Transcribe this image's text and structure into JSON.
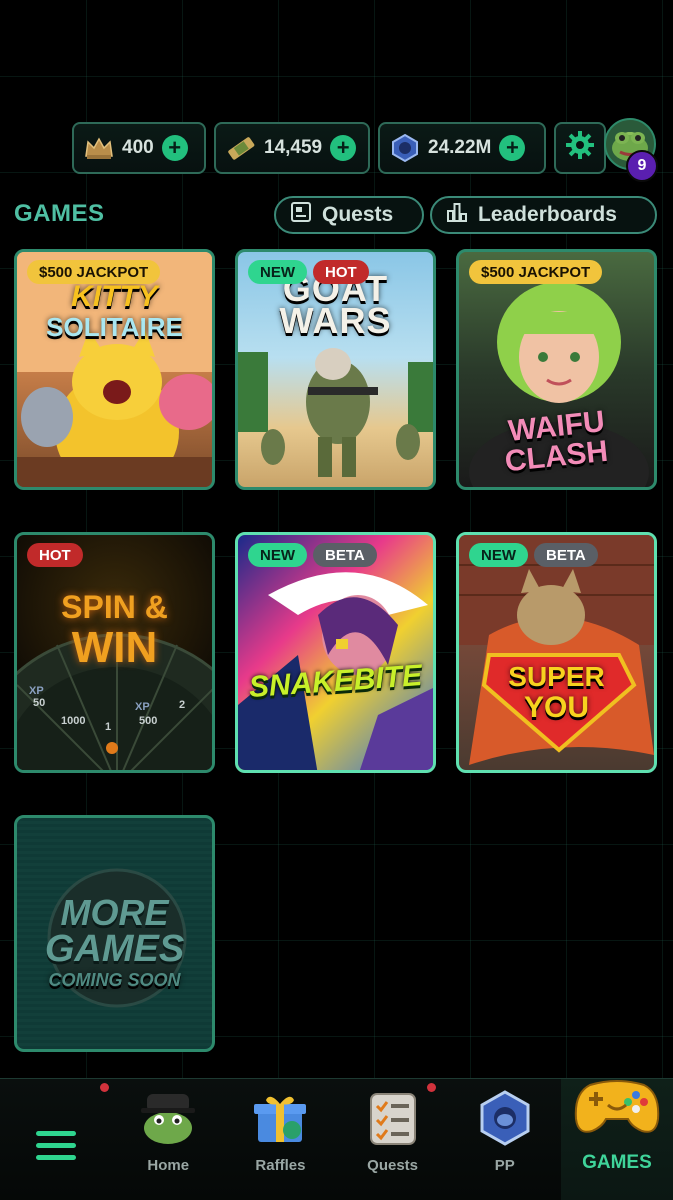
{
  "header": {
    "crowns": "400",
    "tickets": "14,459",
    "pp": "24.22M",
    "notification_count": "9"
  },
  "section": {
    "title": "GAMES",
    "quests_label": "Quests",
    "leaderboards_label": "Leaderboards"
  },
  "games": [
    {
      "tags": [
        "$500 JACKPOT"
      ],
      "title_line1": "KITTY",
      "title_line2": "SOLITAIRE"
    },
    {
      "tags": [
        "NEW",
        "HOT"
      ],
      "title_line1": "GOAT",
      "title_line2": "WARS"
    },
    {
      "tags": [
        "$500 JACKPOT"
      ],
      "title_line1": "WAIFU",
      "title_line2": "CLASH"
    },
    {
      "tags": [
        "HOT"
      ],
      "title_line1": "SPIN &",
      "title_line2": "WIN",
      "wheel_values": [
        "XP",
        "50",
        "1000",
        "1",
        "XP",
        "500",
        "2"
      ]
    },
    {
      "tags": [
        "NEW",
        "BETA"
      ],
      "title_line1": "SNAKEBITE",
      "title_line2": ""
    },
    {
      "tags": [
        "NEW",
        "BETA"
      ],
      "title_line1": "SUPER",
      "title_line2": "YOU"
    },
    {
      "tags": [],
      "title_line1": "MORE",
      "title_line2": "GAMES",
      "title_line3": "COMING SOON"
    }
  ],
  "nav": {
    "home": "Home",
    "raffles": "Raffles",
    "quests": "Quests",
    "pp": "PP",
    "games": "GAMES"
  },
  "colors": {
    "accent": "#2fd58f",
    "border": "#2d8a6c",
    "title": "#4fbfa3",
    "jackpot": "#f1c43c",
    "hot": "#c12a2a",
    "beta": "#5a5f66"
  }
}
